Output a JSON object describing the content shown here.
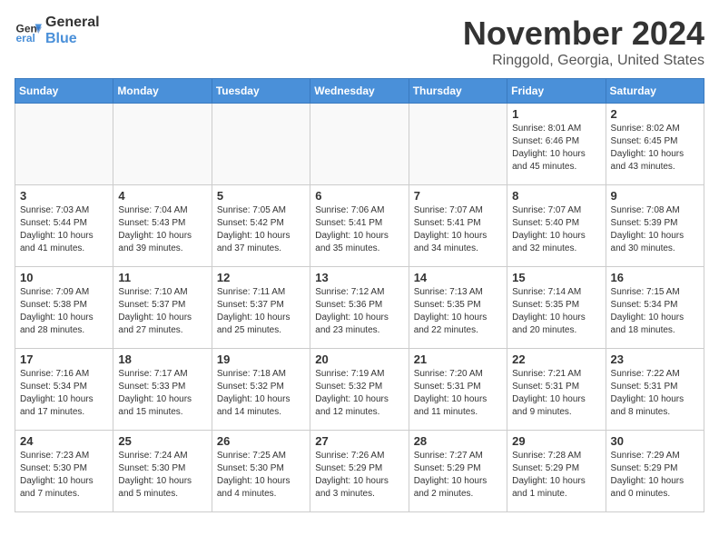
{
  "header": {
    "logo_general": "General",
    "logo_blue": "Blue",
    "month_title": "November 2024",
    "location": "Ringgold, Georgia, United States"
  },
  "weekdays": [
    "Sunday",
    "Monday",
    "Tuesday",
    "Wednesday",
    "Thursday",
    "Friday",
    "Saturday"
  ],
  "weeks": [
    [
      {
        "day": "",
        "text": ""
      },
      {
        "day": "",
        "text": ""
      },
      {
        "day": "",
        "text": ""
      },
      {
        "day": "",
        "text": ""
      },
      {
        "day": "",
        "text": ""
      },
      {
        "day": "1",
        "text": "Sunrise: 8:01 AM\nSunset: 6:46 PM\nDaylight: 10 hours\nand 45 minutes."
      },
      {
        "day": "2",
        "text": "Sunrise: 8:02 AM\nSunset: 6:45 PM\nDaylight: 10 hours\nand 43 minutes."
      }
    ],
    [
      {
        "day": "3",
        "text": "Sunrise: 7:03 AM\nSunset: 5:44 PM\nDaylight: 10 hours\nand 41 minutes."
      },
      {
        "day": "4",
        "text": "Sunrise: 7:04 AM\nSunset: 5:43 PM\nDaylight: 10 hours\nand 39 minutes."
      },
      {
        "day": "5",
        "text": "Sunrise: 7:05 AM\nSunset: 5:42 PM\nDaylight: 10 hours\nand 37 minutes."
      },
      {
        "day": "6",
        "text": "Sunrise: 7:06 AM\nSunset: 5:41 PM\nDaylight: 10 hours\nand 35 minutes."
      },
      {
        "day": "7",
        "text": "Sunrise: 7:07 AM\nSunset: 5:41 PM\nDaylight: 10 hours\nand 34 minutes."
      },
      {
        "day": "8",
        "text": "Sunrise: 7:07 AM\nSunset: 5:40 PM\nDaylight: 10 hours\nand 32 minutes."
      },
      {
        "day": "9",
        "text": "Sunrise: 7:08 AM\nSunset: 5:39 PM\nDaylight: 10 hours\nand 30 minutes."
      }
    ],
    [
      {
        "day": "10",
        "text": "Sunrise: 7:09 AM\nSunset: 5:38 PM\nDaylight: 10 hours\nand 28 minutes."
      },
      {
        "day": "11",
        "text": "Sunrise: 7:10 AM\nSunset: 5:37 PM\nDaylight: 10 hours\nand 27 minutes."
      },
      {
        "day": "12",
        "text": "Sunrise: 7:11 AM\nSunset: 5:37 PM\nDaylight: 10 hours\nand 25 minutes."
      },
      {
        "day": "13",
        "text": "Sunrise: 7:12 AM\nSunset: 5:36 PM\nDaylight: 10 hours\nand 23 minutes."
      },
      {
        "day": "14",
        "text": "Sunrise: 7:13 AM\nSunset: 5:35 PM\nDaylight: 10 hours\nand 22 minutes."
      },
      {
        "day": "15",
        "text": "Sunrise: 7:14 AM\nSunset: 5:35 PM\nDaylight: 10 hours\nand 20 minutes."
      },
      {
        "day": "16",
        "text": "Sunrise: 7:15 AM\nSunset: 5:34 PM\nDaylight: 10 hours\nand 18 minutes."
      }
    ],
    [
      {
        "day": "17",
        "text": "Sunrise: 7:16 AM\nSunset: 5:34 PM\nDaylight: 10 hours\nand 17 minutes."
      },
      {
        "day": "18",
        "text": "Sunrise: 7:17 AM\nSunset: 5:33 PM\nDaylight: 10 hours\nand 15 minutes."
      },
      {
        "day": "19",
        "text": "Sunrise: 7:18 AM\nSunset: 5:32 PM\nDaylight: 10 hours\nand 14 minutes."
      },
      {
        "day": "20",
        "text": "Sunrise: 7:19 AM\nSunset: 5:32 PM\nDaylight: 10 hours\nand 12 minutes."
      },
      {
        "day": "21",
        "text": "Sunrise: 7:20 AM\nSunset: 5:31 PM\nDaylight: 10 hours\nand 11 minutes."
      },
      {
        "day": "22",
        "text": "Sunrise: 7:21 AM\nSunset: 5:31 PM\nDaylight: 10 hours\nand 9 minutes."
      },
      {
        "day": "23",
        "text": "Sunrise: 7:22 AM\nSunset: 5:31 PM\nDaylight: 10 hours\nand 8 minutes."
      }
    ],
    [
      {
        "day": "24",
        "text": "Sunrise: 7:23 AM\nSunset: 5:30 PM\nDaylight: 10 hours\nand 7 minutes."
      },
      {
        "day": "25",
        "text": "Sunrise: 7:24 AM\nSunset: 5:30 PM\nDaylight: 10 hours\nand 5 minutes."
      },
      {
        "day": "26",
        "text": "Sunrise: 7:25 AM\nSunset: 5:30 PM\nDaylight: 10 hours\nand 4 minutes."
      },
      {
        "day": "27",
        "text": "Sunrise: 7:26 AM\nSunset: 5:29 PM\nDaylight: 10 hours\nand 3 minutes."
      },
      {
        "day": "28",
        "text": "Sunrise: 7:27 AM\nSunset: 5:29 PM\nDaylight: 10 hours\nand 2 minutes."
      },
      {
        "day": "29",
        "text": "Sunrise: 7:28 AM\nSunset: 5:29 PM\nDaylight: 10 hours\nand 1 minute."
      },
      {
        "day": "30",
        "text": "Sunrise: 7:29 AM\nSunset: 5:29 PM\nDaylight: 10 hours\nand 0 minutes."
      }
    ]
  ]
}
